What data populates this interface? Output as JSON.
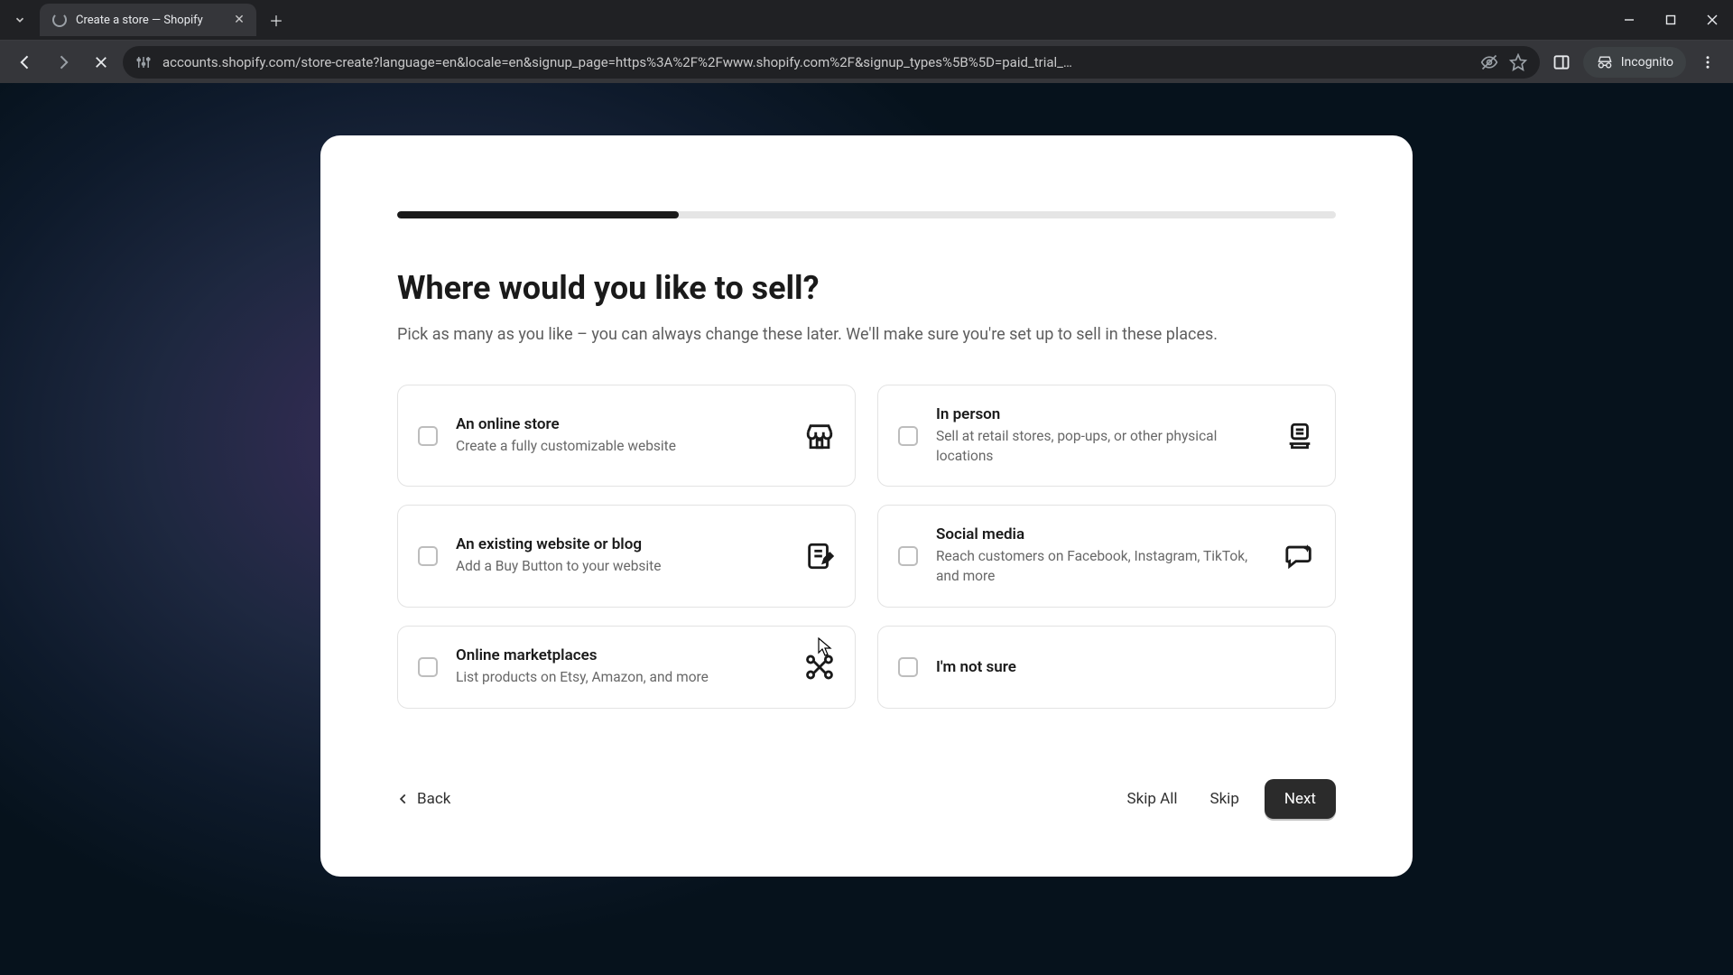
{
  "browser": {
    "tab": {
      "title": "Create a store — Shopify"
    },
    "url": "accounts.shopify.com/store-create?language=en&locale=en&signup_page=https%3A%2F%2Fwww.shopify.com%2F&signup_types%5B%5D=paid_trial_…",
    "incognito_label": "Incognito"
  },
  "card": {
    "progress_percent": 30,
    "heading": "Where would you like to sell?",
    "subheading": "Pick as many as you like – you can always change these later. We'll make sure you're set up to sell in these places.",
    "options": [
      {
        "title": "An online store",
        "desc": "Create a fully customizable website"
      },
      {
        "title": "In person",
        "desc": "Sell at retail stores, pop-ups, or other physical locations"
      },
      {
        "title": "An existing website or blog",
        "desc": "Add a Buy Button to your website"
      },
      {
        "title": "Social media",
        "desc": "Reach customers on Facebook, Instagram, TikTok, and more"
      },
      {
        "title": "Online marketplaces",
        "desc": "List products on Etsy, Amazon, and more"
      },
      {
        "title": "I'm not sure",
        "desc": ""
      }
    ],
    "footer": {
      "back": "Back",
      "skip_all": "Skip All",
      "skip": "Skip",
      "next": "Next"
    }
  }
}
